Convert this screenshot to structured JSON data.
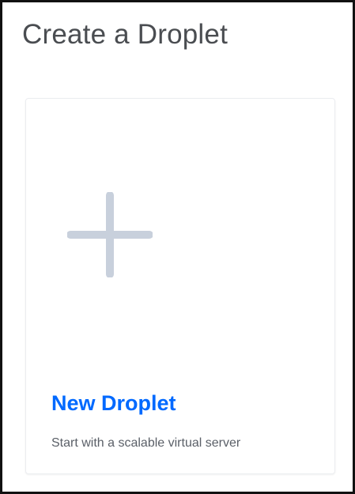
{
  "page": {
    "title": "Create a Droplet"
  },
  "card": {
    "icon": "plus-icon",
    "title": "New Droplet",
    "description": "Start with a scalable virtual server"
  },
  "colors": {
    "accent": "#0069ff",
    "icon": "#c8d0dc",
    "title_text": "#4a4d51",
    "description_text": "#5b6068"
  }
}
